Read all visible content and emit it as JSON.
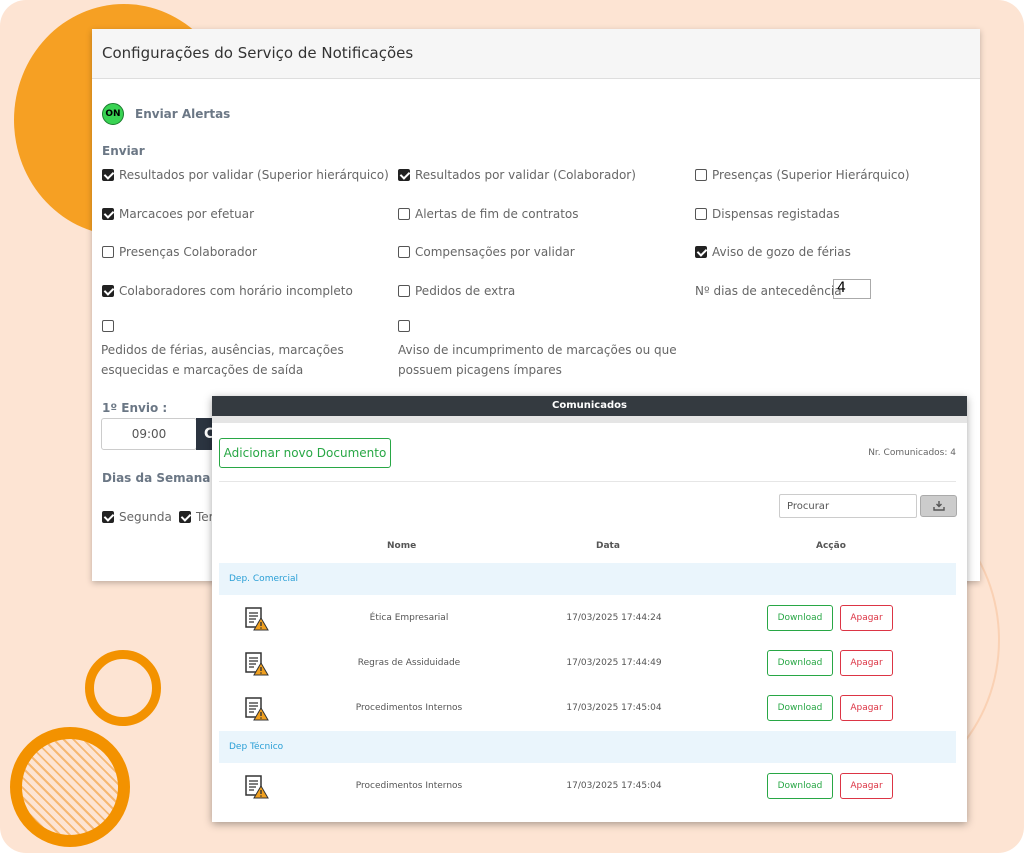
{
  "settings": {
    "title": "Configurações do Serviço de Notificações",
    "alerts_toggle": {
      "state": "ON",
      "label": "Enviar Alertas"
    },
    "send_heading": "Enviar",
    "options": [
      {
        "label": "Resultados por validar (Superior hierárquico)",
        "checked": true
      },
      {
        "label": "Resultados por validar (Colaborador)",
        "checked": true
      },
      {
        "label": "Presenças (Superior Hierárquico)",
        "checked": false
      },
      {
        "label": "Marcacoes por efetuar",
        "checked": true
      },
      {
        "label": "Alertas de fim de contratos",
        "checked": false
      },
      {
        "label": "Dispensas registadas",
        "checked": false
      },
      {
        "label": "Presenças Colaborador",
        "checked": false
      },
      {
        "label": "Compensações por validar",
        "checked": false
      },
      {
        "label": "Aviso de gozo de férias",
        "checked": true
      },
      {
        "label": "Colaboradores com horário incompleto",
        "checked": true
      },
      {
        "label": "Pedidos de extra",
        "checked": false
      },
      {
        "label": "Pedidos de férias, ausências, marcações esquecidas e marcações de saída",
        "checked": false
      },
      {
        "label": "Aviso de incumprimento de marcações ou que possuem picagens ímpares",
        "checked": false
      }
    ],
    "multiline": {
      "opt12_line1": "Pedidos de férias, ausências, marcações",
      "opt12_line2": "esquecidas e marcações de saída",
      "opt13_line1": "Aviso de incumprimento de marcações ou que",
      "opt13_line2": "possuem picagens ímpares"
    },
    "days_ahead": {
      "label": "Nº dias de antecedência",
      "value": "4"
    },
    "first_send": {
      "label": "1º Envio :",
      "time": "09:00",
      "button_fragment": "C"
    },
    "weekdays": {
      "label": "Dias da Semana",
      "items": [
        {
          "label": "Segunda",
          "checked": true
        },
        {
          "label": "Ter",
          "checked": true
        }
      ]
    }
  },
  "comunicados": {
    "title": "Comunicados",
    "add_button": "Adicionar novo Documento",
    "count_text": "Nr. Comunicados: 4",
    "search_placeholder": "Procurar",
    "export_icon": "download-tray-icon",
    "columns": [
      "Nome",
      "Data",
      "Acção"
    ],
    "groups": [
      {
        "name": "Dep. Comercial",
        "docs": [
          {
            "name": "Ética Empresarial",
            "date": "17/03/2025 17:44:24"
          },
          {
            "name": "Regras de Assiduidade",
            "date": "17/03/2025 17:44:49"
          },
          {
            "name": "Procedimentos Internos",
            "date": "17/03/2025 17:45:04"
          }
        ]
      },
      {
        "name": "Dep Técnico",
        "docs": [
          {
            "name": "Procedimentos Internos",
            "date": "17/03/2025 17:45:04"
          }
        ]
      }
    ],
    "download_label": "Download",
    "delete_label": "Apagar"
  },
  "colors": {
    "background": "#fde4d3",
    "accent_orange": "#f39200",
    "success": "#28a745",
    "danger": "#dc3545",
    "header_dark": "#343a40",
    "group_bg": "#eaf5fc",
    "group_text": "#2a9fd6"
  }
}
